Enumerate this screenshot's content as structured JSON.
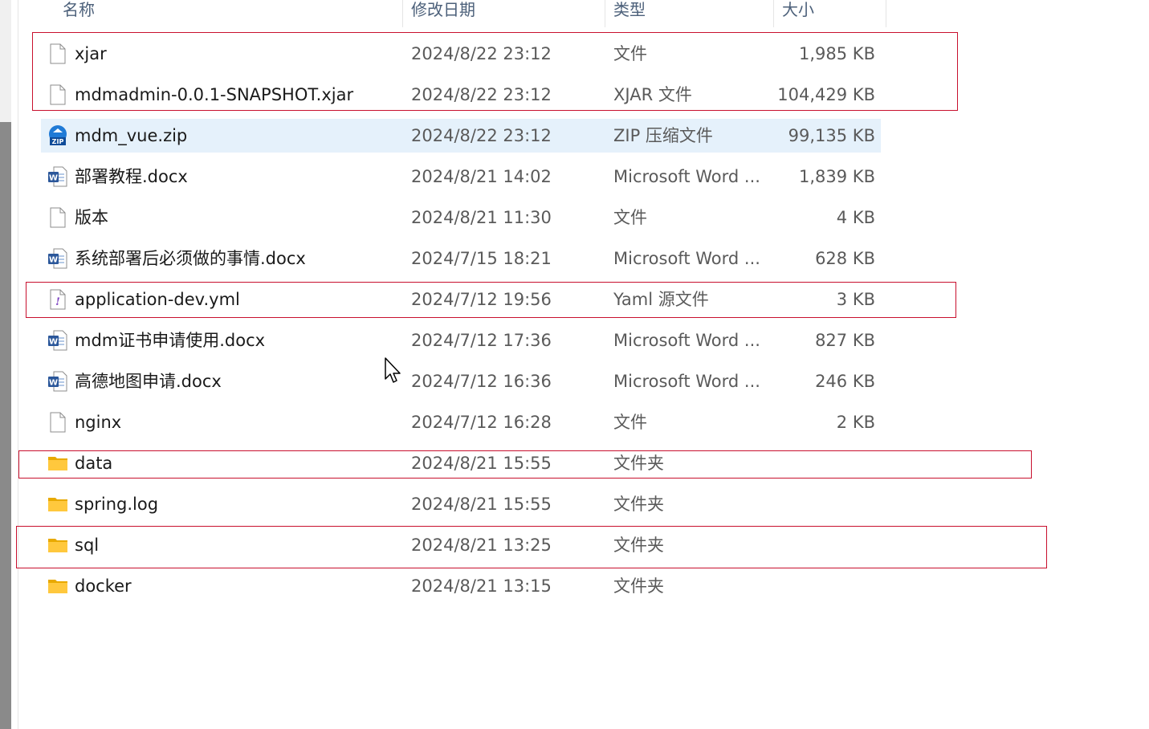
{
  "columns": {
    "name": "名称",
    "date": "修改日期",
    "type": "类型",
    "size": "大小"
  },
  "files": [
    {
      "name": "xjar",
      "date": "2024/8/22 23:12",
      "type": "文件",
      "size": "1,985 KB",
      "icon": "file-icon"
    },
    {
      "name": "mdmadmin-0.0.1-SNAPSHOT.xjar",
      "date": "2024/8/22 23:12",
      "type": "XJAR 文件",
      "size": "104,429 KB",
      "icon": "file-icon"
    },
    {
      "name": "mdm_vue.zip",
      "date": "2024/8/22 23:12",
      "type": "ZIP 压缩文件",
      "size": "99,135 KB",
      "icon": "zip-icon"
    },
    {
      "name": "部署教程.docx",
      "date": "2024/8/21 14:02",
      "type": "Microsoft Word ...",
      "size": "1,839 KB",
      "icon": "word-icon"
    },
    {
      "name": "版本",
      "date": "2024/8/21 11:30",
      "type": "文件",
      "size": "4 KB",
      "icon": "file-icon"
    },
    {
      "name": "系统部署后必须做的事情.docx",
      "date": "2024/7/15 18:21",
      "type": "Microsoft Word ...",
      "size": "628 KB",
      "icon": "word-icon"
    },
    {
      "name": "application-dev.yml",
      "date": "2024/7/12 19:56",
      "type": "Yaml 源文件",
      "size": "3 KB",
      "icon": "yaml-icon"
    },
    {
      "name": "mdm证书申请使用.docx",
      "date": "2024/7/12 17:36",
      "type": "Microsoft Word ...",
      "size": "827 KB",
      "icon": "word-icon"
    },
    {
      "name": "高德地图申请.docx",
      "date": "2024/7/12 16:36",
      "type": "Microsoft Word ...",
      "size": "246 KB",
      "icon": "word-icon"
    },
    {
      "name": "nginx",
      "date": "2024/7/12 16:28",
      "type": "文件",
      "size": "2 KB",
      "icon": "file-icon"
    },
    {
      "name": "data",
      "date": "2024/8/21 15:55",
      "type": "文件夹",
      "size": "",
      "icon": "folder-icon"
    },
    {
      "name": "spring.log",
      "date": "2024/8/21 15:55",
      "type": "文件夹",
      "size": "",
      "icon": "folder-icon"
    },
    {
      "name": "sql",
      "date": "2024/8/21 13:25",
      "type": "文件夹",
      "size": "",
      "icon": "folder-icon"
    },
    {
      "name": "docker",
      "date": "2024/8/21 13:15",
      "type": "文件夹",
      "size": "",
      "icon": "folder-icon"
    }
  ],
  "selected_file": "mdm_vue.zip",
  "colors": {
    "highlight_box": "#c8102e",
    "selection": "#e5f1fb",
    "header_text": "#4c607a"
  }
}
